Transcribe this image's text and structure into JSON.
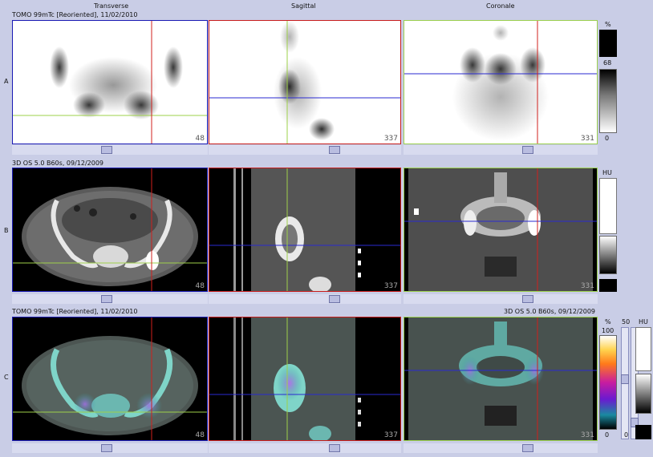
{
  "columns": {
    "transverse": "Transverse",
    "sagittal": "Sagittal",
    "coronal": "Coronale"
  },
  "rows": {
    "a": "A",
    "b": "B",
    "c": "C"
  },
  "row_a": {
    "header": "TOMO 99mTc [Reoriented], 11/02/2010",
    "slices": [
      "48",
      "337",
      "331"
    ]
  },
  "row_b": {
    "header": "3D  OS  5.0  B60s, 09/12/2009",
    "slices": [
      "48",
      "337",
      "331"
    ]
  },
  "row_c": {
    "header_left": "TOMO 99mTc [Reoriented], 11/02/2010",
    "header_right": "3D  OS  5.0  B60s, 09/12/2009",
    "slices": [
      "48",
      "337",
      "331"
    ]
  },
  "scale_a": {
    "unit": "%",
    "max": "68",
    "min": "0"
  },
  "scale_b": {
    "unit": "HU"
  },
  "scale_c": {
    "unit": "%",
    "max": "100",
    "min": "0",
    "threshold": "50",
    "hu_unit": "HU",
    "hu_min": "0"
  },
  "colors": {
    "frame_blue": "#1a1ab4",
    "frame_red": "#c81c1c",
    "frame_green": "#9bd04d",
    "cross_red": "#d0201d",
    "cross_green": "#9ed04a",
    "cross_blue": "#2a2ad0"
  }
}
